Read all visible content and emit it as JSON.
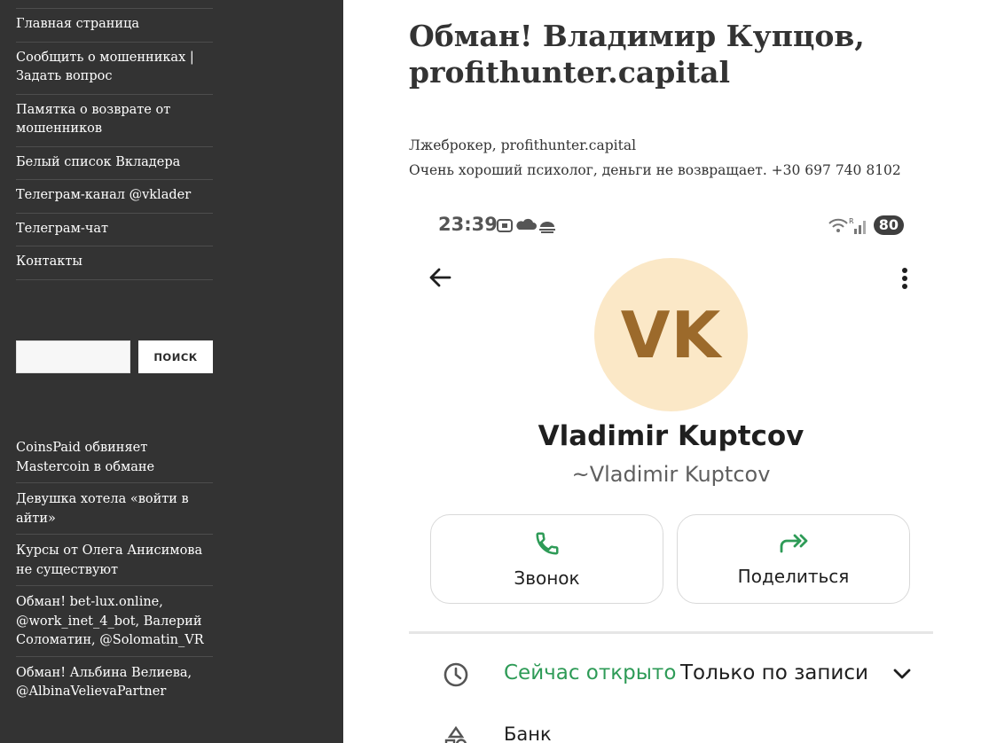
{
  "sidebar": {
    "menu": [
      {
        "label": "Главная страница"
      },
      {
        "label": "Сообщить о мошенниках | Задать вопрос"
      },
      {
        "label": "Памятка о возврате от мошенников"
      },
      {
        "label": "Белый список Вкладера"
      },
      {
        "label": "Телеграм-канал @vklader"
      },
      {
        "label": "Телеграм-чат"
      },
      {
        "label": "Контакты"
      }
    ],
    "search": {
      "placeholder": "",
      "button_label": "ПОИСК"
    },
    "recent_posts": [
      {
        "label": "CoinsPaid обвиняет Mastercoin в обмане"
      },
      {
        "label": "Девушка хотела «войти в айти»"
      },
      {
        "label": "Курсы от Олега Анисимова не существуют"
      },
      {
        "label": "Обман! bet-lux.online, @work_inet_4_bot, Валерий Соломатин, @Solomatin_VR"
      },
      {
        "label": "Обман! Альбина Велиева, @AlbinaVelievaPartner"
      }
    ]
  },
  "post": {
    "title": "Обман! Владимир Купцов, profithunter.capital",
    "paragraphs": [
      "Лжеброкер, profithunter.capital",
      "Очень хороший психолог, деньги не возвращает. +30 697 740 8102"
    ]
  },
  "screenshot": {
    "status_time": "23:39",
    "battery": "80",
    "avatar_initials": "VK",
    "contact_name": "Vladimir Kuptcov",
    "contact_subtitle": "~Vladimir Kuptcov",
    "call_label": "Звонок",
    "share_label": "Поделиться",
    "open_status": "Сейчас открыто",
    "hours_text": "Только по записи",
    "category": "Банк",
    "colors": {
      "accent_green": "#2e9b57",
      "avatar_bg": "#fbe8c7",
      "avatar_text": "#9c6a2b",
      "sidebar_bg": "#333333"
    }
  }
}
